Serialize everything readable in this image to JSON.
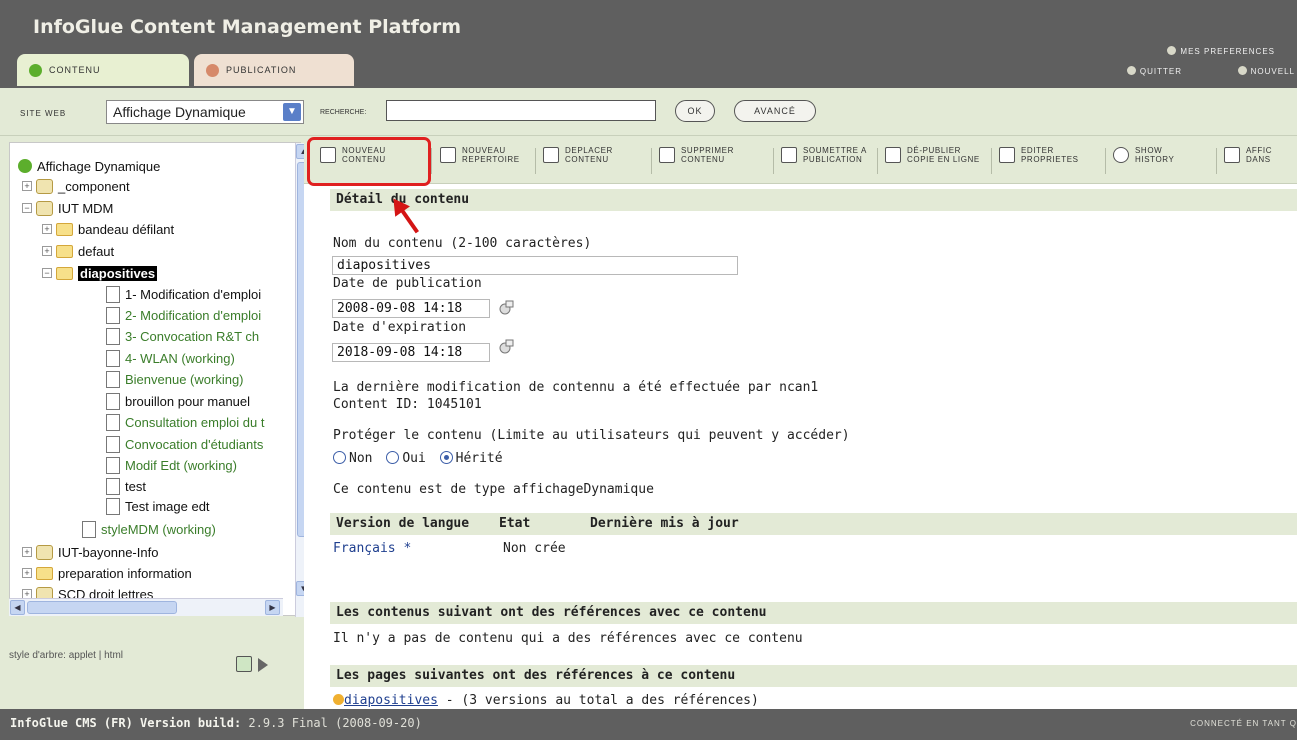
{
  "app": {
    "title": "InfoGlue Content Management Platform"
  },
  "tabs": [
    {
      "label": "Contenu"
    },
    {
      "label": "Publication"
    }
  ],
  "toplinks": {
    "preferences": "Mes preferences",
    "quit": "Quitter",
    "new": "Nouvell"
  },
  "sitebar": {
    "site_label": "Site web",
    "site_value": "Affichage Dynamique",
    "search_label": "Recherche:",
    "search_value": "",
    "ok_label": "OK",
    "advanced_label": "Avancé"
  },
  "tree": {
    "root": "Affichage Dynamique",
    "items": [
      {
        "label": "_component"
      },
      {
        "label": "IUT MDM"
      },
      {
        "label": "bandeau défilant"
      },
      {
        "label": "defaut"
      },
      {
        "label": "diapositives"
      },
      {
        "label": "1- Modification d'emploi"
      },
      {
        "label": "2- Modification d'emploi"
      },
      {
        "label": "3- Convocation R&T ch"
      },
      {
        "label": "4- WLAN (working)"
      },
      {
        "label": "Bienvenue (working)"
      },
      {
        "label": "brouillon pour manuel"
      },
      {
        "label": "Consultation emploi du t"
      },
      {
        "label": "Convocation d'étudiants"
      },
      {
        "label": "Modif Edt (working)"
      },
      {
        "label": "test"
      },
      {
        "label": "Test image edt"
      },
      {
        "label": "styleMDM (working)"
      },
      {
        "label": "IUT-bayonne-Info"
      },
      {
        "label": "preparation information"
      },
      {
        "label": "SCD droit lettres"
      }
    ],
    "style_note": "style d'arbre: applet | html"
  },
  "toolbar": [
    {
      "line1": "Nouveau",
      "line2": "contenu"
    },
    {
      "line1": "Nouveau",
      "line2": "repertoire"
    },
    {
      "line1": "Deplacer",
      "line2": "contenu"
    },
    {
      "line1": "Supprimer",
      "line2": "contenu"
    },
    {
      "line1": "Soumettre a",
      "line2": "publication"
    },
    {
      "line1": "Dé-publier",
      "line2": "copie en ligne"
    },
    {
      "line1": "Editer",
      "line2": "proprietes"
    },
    {
      "line1": "Show",
      "line2": "history"
    },
    {
      "line1": "Affic",
      "line2": "dans"
    }
  ],
  "detail": {
    "header": "Détail du contenu",
    "name_label": "Nom du contenu (2-100 caractères)",
    "name_value": "diapositives",
    "pub_label": "Date de publication",
    "pub_value": "2008-09-08 14:18",
    "exp_label": "Date d'expiration",
    "exp_value": "2018-09-08 14:18",
    "last_mod": "La dernière modification de contennu a été effectuée par ncan1",
    "content_id": "Content ID: 1045101",
    "protect_label": "Protéger le contenu (Limite au utilisateurs qui peuvent y accéder)",
    "protect_options": [
      "Non",
      "Oui",
      "Hérité"
    ],
    "protect_selected": "Hérité",
    "type_text": "Ce contenu est de type affichageDynamique"
  },
  "versions": {
    "headers": [
      "Version de langue",
      "Etat",
      "Dernière mis à jour"
    ],
    "rows": [
      {
        "lang": "Français *",
        "state": "Non crée"
      }
    ]
  },
  "references": {
    "header1": "Les contenus suivant ont des références avec ce contenu",
    "text1": "Il n'y a pas de contenu qui a des références avec ce contenu",
    "header2": "Les pages suivantes ont des références à ce contenu",
    "link": "diapositives",
    "link_suffix": " - (3 versions au total a des références)"
  },
  "status": {
    "label": "InfoGlue CMS (FR) Version build:",
    "version": " 2.9.3 Final (2008-09-20)",
    "connected": "Connecté en tant q"
  }
}
